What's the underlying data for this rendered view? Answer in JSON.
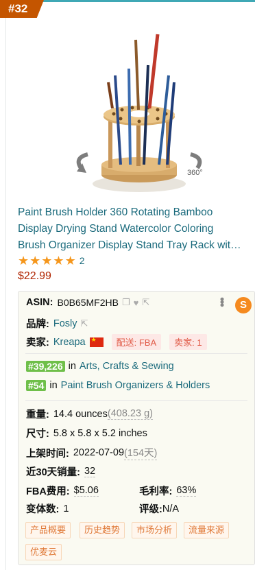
{
  "badge": {
    "rank": "#32"
  },
  "product": {
    "title_lines": [
      "Paint Brush Holder 360 Rotating Bamboo",
      "Display Drying Stand Watercolor Coloring",
      "Brush Organizer Display Stand Tray Rack wit…"
    ],
    "rating": 5,
    "stars": [
      "★",
      "★",
      "★",
      "★",
      "★"
    ],
    "review_count": "2",
    "price": "$22.99",
    "image_badge": "360°"
  },
  "panel": {
    "asin_label": "ASIN:",
    "asin_value": "B0B65MF2HB",
    "brand_label": "品牌:",
    "brand_value": "Fosly",
    "seller_label": "卖家:",
    "seller_value": "Kreapa",
    "shipping_chip": "配送: FBA",
    "sellers_chip": "卖家: 1",
    "logo_letter": "S",
    "ranks": [
      {
        "rank": "#39,226",
        "in": "in",
        "category": "Arts, Crafts & Sewing"
      },
      {
        "rank": "#54",
        "in": "in",
        "category": "Paint Brush Organizers & Holders"
      }
    ],
    "weight_label": "重量:",
    "weight_value": "14.4 ounces",
    "weight_grams": "(408.23 g)",
    "size_label": "尺寸:",
    "size_value": "5.8 x 5.8 x 5.2 inches",
    "listed_label": "上架时间:",
    "listed_value": "2022-07-09",
    "listed_days": "(154天)",
    "sales_label": "近30天销量:",
    "sales_value": "32",
    "fba_label": "FBA费用:",
    "fba_value": "$5.06",
    "margin_label": "毛利率:",
    "margin_value": "63%",
    "variants_label": "变体数:",
    "variants_value": "1",
    "grade_label": "评级:",
    "grade_value": "N/A",
    "tags": [
      "产品概要",
      "历史趋势",
      "市场分析",
      "流量来源",
      "优麦云"
    ]
  },
  "colors": {
    "badge": "#c45500",
    "link": "#1a6a7c",
    "price": "#b12704",
    "star": "#f5961b",
    "rank_chip": "#6fbf4a",
    "tag_text": "#e07b3a"
  }
}
